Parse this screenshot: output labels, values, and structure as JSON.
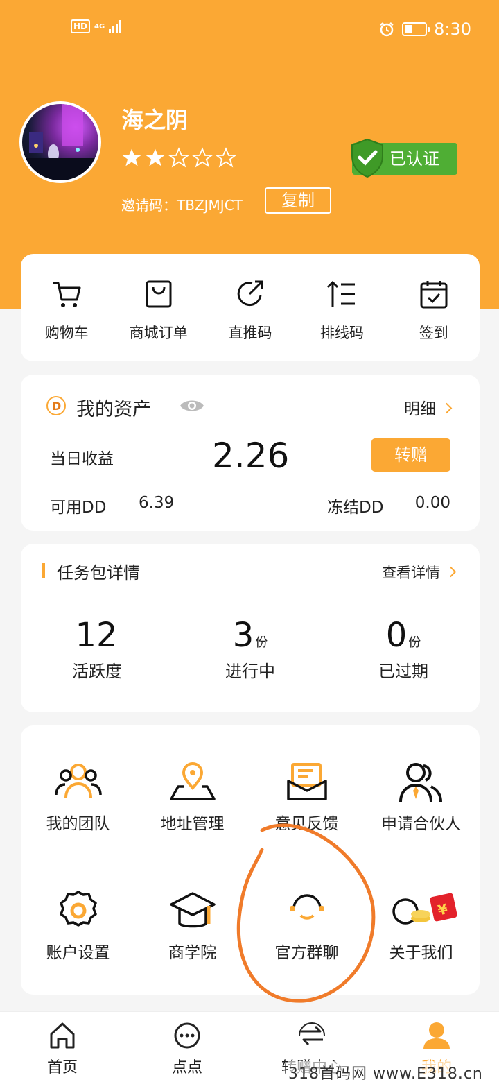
{
  "status_bar": {
    "network": "HD",
    "signal_label": "4G",
    "time": "8:30"
  },
  "profile": {
    "username": "海之阴",
    "rating": {
      "filled": 2,
      "total": 5
    },
    "invite_label": "邀请码：",
    "invite_code": "TBZJMJCT",
    "copy_label": "复制",
    "verified_label": "已认证"
  },
  "quick_actions": [
    {
      "label": "购物车",
      "icon": "cart-icon"
    },
    {
      "label": "商城订单",
      "icon": "shopping-bag-icon"
    },
    {
      "label": "直推码",
      "icon": "share-arrow-icon"
    },
    {
      "label": "排线码",
      "icon": "sort-list-icon"
    },
    {
      "label": "签到",
      "icon": "calendar-check-icon"
    }
  ],
  "assets": {
    "title": "我的资产",
    "detail_label": "明细",
    "today_label": "当日收益",
    "today_value": "2.26",
    "transfer_label": "转赠",
    "available_label": "可用DD",
    "available_value": "6.39",
    "frozen_label": "冻结DD",
    "frozen_value": "0.00"
  },
  "tasks": {
    "title": "任务包详情",
    "detail_label": "查看详情",
    "stats": [
      {
        "value": "12",
        "unit": "",
        "label": "活跃度"
      },
      {
        "value": "3",
        "unit": "份",
        "label": "进行中"
      },
      {
        "value": "0",
        "unit": "份",
        "label": "已过期"
      }
    ]
  },
  "menu": [
    {
      "label": "我的团队",
      "icon": "team-icon"
    },
    {
      "label": "地址管理",
      "icon": "location-pin-icon"
    },
    {
      "label": "意见反馈",
      "icon": "feedback-mail-icon"
    },
    {
      "label": "申请合伙人",
      "icon": "partner-icon"
    },
    {
      "label": "账户设置",
      "icon": "gear-icon"
    },
    {
      "label": "商学院",
      "icon": "graduation-cap-icon"
    },
    {
      "label": "官方群聊",
      "icon": "headset-icon"
    },
    {
      "label": "关于我们",
      "icon": "about-red-envelope-icon"
    }
  ],
  "tabbar": [
    {
      "label": "首页",
      "icon": "home-icon",
      "active": false
    },
    {
      "label": "点点",
      "icon": "dots-icon",
      "active": false
    },
    {
      "label": "转赠中心",
      "icon": "transfer-icon",
      "active": false
    },
    {
      "label": "我的",
      "icon": "user-icon",
      "active": true
    }
  ],
  "watermark": "318首码网 www.E318.cn",
  "colors": {
    "brand": "#fba834",
    "verified": "#4fae34",
    "annotation": "#f07b2a",
    "envelope": "#e3222b"
  }
}
